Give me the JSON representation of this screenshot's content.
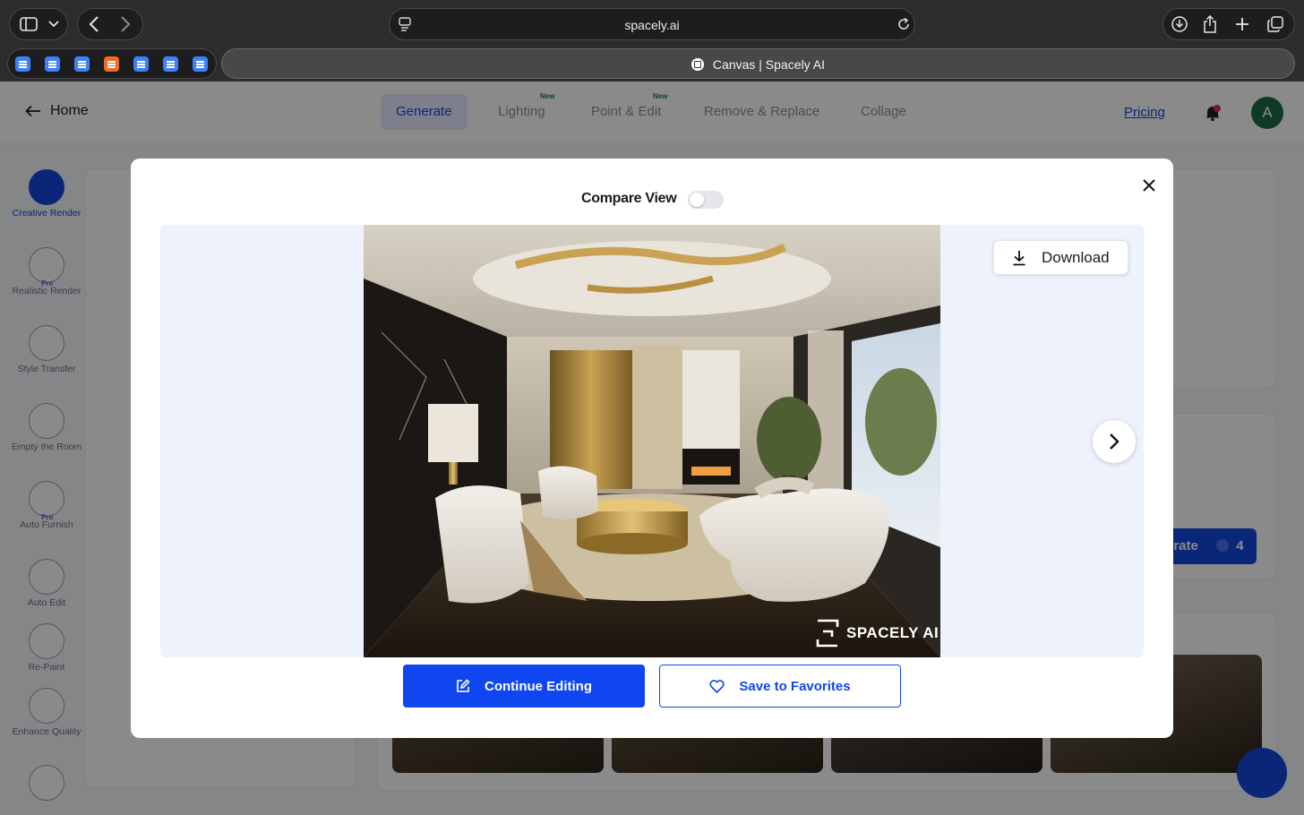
{
  "browser": {
    "url": "spacely.ai",
    "active_tab_title": "Canvas | Spacely AI"
  },
  "app": {
    "home_label": "Home",
    "nav_tabs": [
      {
        "label": "Generate",
        "badge": ""
      },
      {
        "label": "Lighting",
        "badge": "New"
      },
      {
        "label": "Point & Edit",
        "badge": "New"
      },
      {
        "label": "Remove & Replace",
        "badge": ""
      },
      {
        "label": "Collage",
        "badge": ""
      }
    ],
    "pricing_label": "Pricing",
    "avatar_initial": "A",
    "sidebar": [
      {
        "label": "Creative Render",
        "pro": ""
      },
      {
        "label": "Realistic Render",
        "pro": "Pro"
      },
      {
        "label": "Style Transfer",
        "pro": ""
      },
      {
        "label": "Empty the Room",
        "pro": ""
      },
      {
        "label": "Auto Furnish",
        "pro": "Pro"
      },
      {
        "label": "Auto Edit",
        "pro": ""
      },
      {
        "label": "Re-Paint",
        "pro": ""
      },
      {
        "label": "Enhance Quality",
        "pro": ""
      }
    ],
    "generate_partial": "erate",
    "generate_credits": "4"
  },
  "modal": {
    "compare_view_label": "Compare View",
    "compare_view_on": false,
    "download_label": "Download",
    "watermark": "SPACELY AI",
    "continue_editing_label": "Continue Editing",
    "save_favorites_label": "Save to Favorites"
  },
  "colors": {
    "primary": "#0f46f0",
    "accent_green": "#1e6b45"
  }
}
